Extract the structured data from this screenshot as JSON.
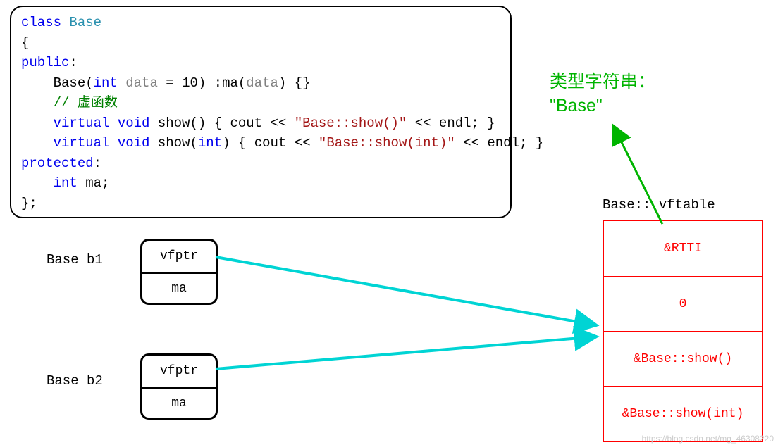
{
  "code": {
    "l1": {
      "kw": "class",
      "cls": "Base"
    },
    "l2": "{",
    "l3": {
      "kw": "public",
      "colon": ":"
    },
    "l4": {
      "ctor": "Base(",
      "kw_int": "int",
      "param": " data",
      "eq": " = 10) :ma(",
      "arg": "data",
      "tail": ") {}"
    },
    "l5": "// 虚函数",
    "l6": {
      "kw1": "virtual",
      "kw2": "void",
      "name": " show() { cout << ",
      "str": "\"Base::show()\"",
      "tail": " << endl; }"
    },
    "l7": {
      "kw1": "virtual",
      "kw2": "void",
      "name": " show(",
      "kw_int": "int",
      "after": ") { cout << ",
      "str": "\"Base::show(int)\"",
      "tail": " << endl; }"
    },
    "l8": {
      "kw": "protected",
      "colon": ":"
    },
    "l9": {
      "kw_int": "int",
      "var": " ma;"
    },
    "l10": "};"
  },
  "objects": {
    "b1": {
      "label": "Base b1",
      "cells": [
        "vfptr",
        "ma"
      ]
    },
    "b2": {
      "label": "Base b2",
      "cells": [
        "vfptr",
        "ma"
      ]
    }
  },
  "vftable": {
    "title": "Base:: vftable",
    "cells": [
      "&RTTI",
      "0",
      "&Base::show()",
      "&Base::show(int)"
    ]
  },
  "type_string": {
    "line1": "类型字符串：",
    "line2": "\"Base\""
  },
  "watermark": "https://blog.csdn.net/mg_46308220"
}
